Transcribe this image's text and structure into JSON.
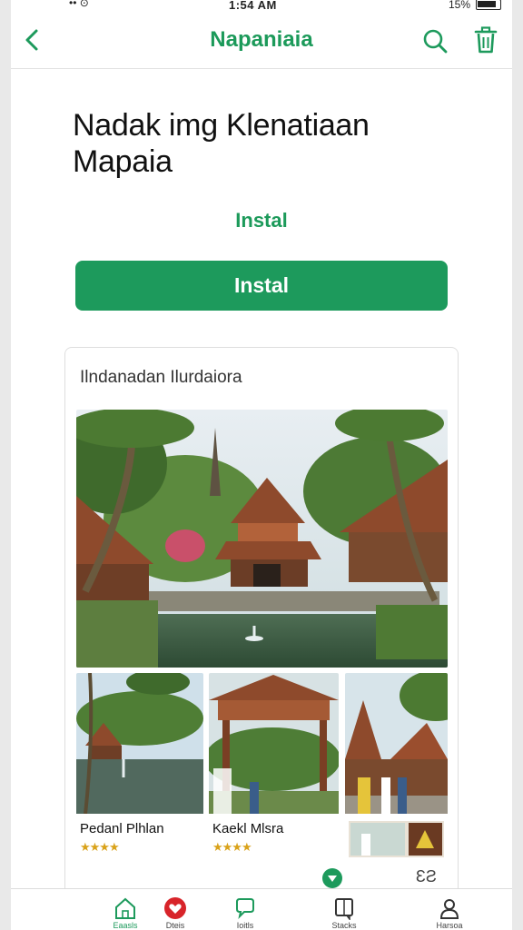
{
  "status_bar": {
    "time": "1:54 AM",
    "battery": "15%",
    "signal": "•• ⊙"
  },
  "top_bar": {
    "title": "Napaniaia"
  },
  "app": {
    "title_line1": "Nadak img Klenatiaan",
    "title_line2": "Mapaia",
    "install_link": "Instal",
    "install_button": "Instal"
  },
  "gallery": {
    "title": "Ilndanadan Ilurdaiora",
    "items": [
      {
        "label": "Pedanl Plhlan",
        "stars": "★★★★"
      },
      {
        "label": "Kaekl Mlsra",
        "stars": "★★★★"
      },
      {
        "label": "",
        "stars": ""
      }
    ]
  },
  "more_glyph": "ƐƧ",
  "tabs": [
    {
      "label": "Eaasls",
      "icon": "home-icon"
    },
    {
      "label": "Dteis",
      "icon": "heart-icon"
    },
    {
      "label": "Ioitls",
      "icon": "chat-icon"
    },
    {
      "label": "Stacks",
      "icon": "book-icon"
    },
    {
      "label": "Harsoa",
      "icon": "profile-icon"
    }
  ],
  "colors": {
    "accent": "#1d9a5c",
    "star": "#d9a21a",
    "tab_active": "#1d9a5c"
  }
}
